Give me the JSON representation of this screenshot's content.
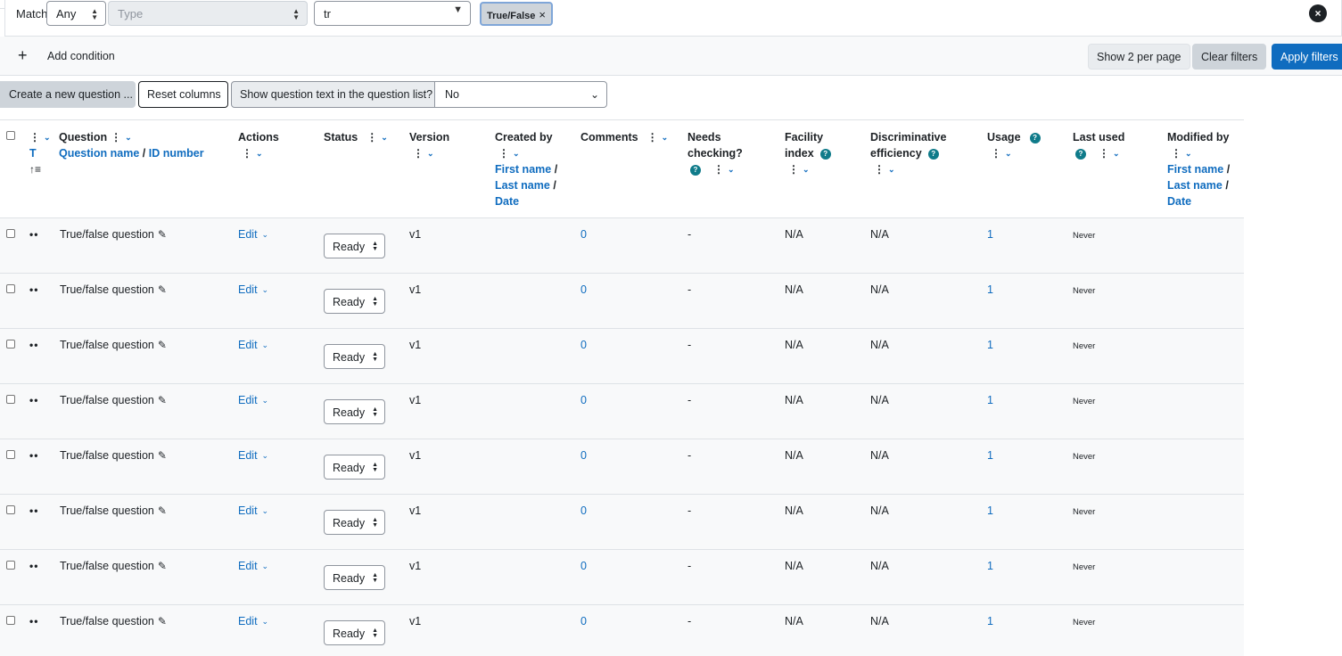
{
  "filter": {
    "match_label": "Match",
    "match_value": "Any",
    "type_placeholder": "Type",
    "search_value": "tr",
    "tag_label": "True/False",
    "tag_remove": "×",
    "close_glyph": "×"
  },
  "actions_bar": {
    "add_condition": "Add condition",
    "show_per_page": "Show 2 per page",
    "clear_filters": "Clear filters",
    "apply_filters": "Apply filters"
  },
  "toolbar": {
    "create_question": "Create a new question ...",
    "reset_columns": "Reset columns",
    "show_text_label": "Show question text in the question list?",
    "show_text_value": "No"
  },
  "table": {
    "headers": {
      "type": "T",
      "question": "Question",
      "question_name": "Question name",
      "slash": "/",
      "id_number": "ID number",
      "actions": "Actions",
      "status": "Status",
      "version": "Version",
      "created_by": "Created by",
      "first_name": "First name",
      "last_name": "Last name",
      "date": "Date",
      "comments": "Comments",
      "needs_checking_1": "Needs",
      "needs_checking_2": "checking?",
      "facility_1": "Facility",
      "facility_2": "index",
      "discrim_1": "Discriminative",
      "discrim_2": "efficiency",
      "usage": "Usage",
      "last_used": "Last used",
      "modified_by": "Modified by"
    },
    "rows": [
      {
        "name": "True/false question",
        "action": "Edit",
        "status": "Ready",
        "version": "v1",
        "comments": "0",
        "needs_checking": "-",
        "facility": "N/A",
        "discrim": "N/A",
        "usage": "1",
        "last_used": "Never"
      },
      {
        "name": "True/false question",
        "action": "Edit",
        "status": "Ready",
        "version": "v1",
        "comments": "0",
        "needs_checking": "-",
        "facility": "N/A",
        "discrim": "N/A",
        "usage": "1",
        "last_used": "Never"
      },
      {
        "name": "True/false question",
        "action": "Edit",
        "status": "Ready",
        "version": "v1",
        "comments": "0",
        "needs_checking": "-",
        "facility": "N/A",
        "discrim": "N/A",
        "usage": "1",
        "last_used": "Never"
      },
      {
        "name": "True/false question",
        "action": "Edit",
        "status": "Ready",
        "version": "v1",
        "comments": "0",
        "needs_checking": "-",
        "facility": "N/A",
        "discrim": "N/A",
        "usage": "1",
        "last_used": "Never"
      },
      {
        "name": "True/false question",
        "action": "Edit",
        "status": "Ready",
        "version": "v1",
        "comments": "0",
        "needs_checking": "-",
        "facility": "N/A",
        "discrim": "N/A",
        "usage": "1",
        "last_used": "Never"
      },
      {
        "name": "True/false question",
        "action": "Edit",
        "status": "Ready",
        "version": "v1",
        "comments": "0",
        "needs_checking": "-",
        "facility": "N/A",
        "discrim": "N/A",
        "usage": "1",
        "last_used": "Never"
      },
      {
        "name": "True/false question",
        "action": "Edit",
        "status": "Ready",
        "version": "v1",
        "comments": "0",
        "needs_checking": "-",
        "facility": "N/A",
        "discrim": "N/A",
        "usage": "1",
        "last_used": "Never"
      },
      {
        "name": "True/false question",
        "action": "Edit",
        "status": "Ready",
        "version": "v1",
        "comments": "0",
        "needs_checking": "-",
        "facility": "N/A",
        "discrim": "N/A",
        "usage": "1",
        "last_used": "Never"
      }
    ]
  },
  "colors": {
    "link": "#0f6cbf",
    "primary": "#0f6cbf",
    "help_icon": "#0f7b8a",
    "row_bg": "#f8f9fa"
  },
  "icons": {
    "kebab": "kebab-menu-icon",
    "chevron": "chevron-down-icon",
    "help": "help-icon",
    "pencil": "pencil-icon",
    "drag": "drag-handle-icon",
    "sort": "sort-ascending-icon",
    "plus": "plus-icon",
    "close": "close-icon"
  }
}
